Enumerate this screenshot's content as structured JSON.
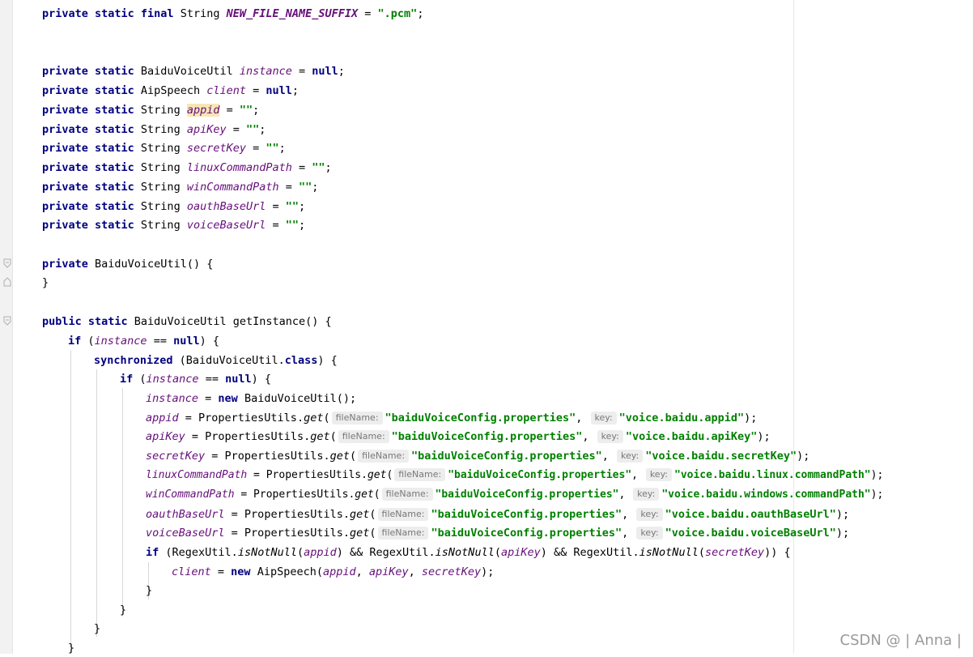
{
  "code": {
    "l01": {
      "a": "private static final",
      "b": " String ",
      "c": "NEW_FILE_NAME_SUFFIX",
      "d": " = ",
      "e": "\".pcm\"",
      "f": ";"
    },
    "l02": {
      "a": "private static",
      "b": " BaiduVoiceUtil ",
      "c": "instance",
      "d": " = ",
      "e": "null",
      "f": ";"
    },
    "l03": {
      "a": "private static",
      "b": " AipSpeech ",
      "c": "client",
      "d": " = ",
      "e": "null",
      "f": ";"
    },
    "l04": {
      "a": "private static",
      "b": " String ",
      "c": "appid",
      "d": " = ",
      "e": "\"\"",
      "f": ";"
    },
    "l05": {
      "a": "private static",
      "b": " String ",
      "c": "apiKey",
      "d": " = ",
      "e": "\"\"",
      "f": ";"
    },
    "l06": {
      "a": "private static",
      "b": " String ",
      "c": "secretKey",
      "d": " = ",
      "e": "\"\"",
      "f": ";"
    },
    "l07": {
      "a": "private static",
      "b": " String ",
      "c": "linuxCommandPath",
      "d": " = ",
      "e": "\"\"",
      "f": ";"
    },
    "l08": {
      "a": "private static",
      "b": " String ",
      "c": "winCommandPath",
      "d": " = ",
      "e": "\"\"",
      "f": ";"
    },
    "l09": {
      "a": "private static",
      "b": " String ",
      "c": "oauthBaseUrl",
      "d": " = ",
      "e": "\"\"",
      "f": ";"
    },
    "l10": {
      "a": "private static",
      "b": " String ",
      "c": "voiceBaseUrl",
      "d": " = ",
      "e": "\"\"",
      "f": ";"
    },
    "l11": {
      "a": "private",
      "b": " BaiduVoiceUtil() {"
    },
    "l12": {
      "a": "}"
    },
    "l13": {
      "a": "public static",
      "b": " BaiduVoiceUtil getInstance() {"
    },
    "l14": {
      "a": "if",
      "b": " (",
      "c": "instance",
      "d": " == ",
      "e": "null",
      "f": ") {"
    },
    "l15": {
      "a": "synchronized",
      "b": " (BaiduVoiceUtil.",
      "c": "class",
      "d": ") {"
    },
    "l16": {
      "a": "if",
      "b": " (",
      "c": "instance",
      "d": " == ",
      "e": "null",
      "f": ") {"
    },
    "l17": {
      "a": "instance",
      "b": " = ",
      "c": "new",
      "d": " BaiduVoiceUtil();"
    },
    "l18": {
      "a": "appid",
      "b": " = PropertiesUtils.",
      "c": "get",
      "d": "(",
      "h1": "fileName:",
      "s1": "\"baiduVoiceConfig.properties\"",
      "m": ", ",
      "h2": "key:",
      "s2": "\"voice.baidu.appid\"",
      "e": ");"
    },
    "l19": {
      "a": "apiKey",
      "b": " = PropertiesUtils.",
      "c": "get",
      "d": "(",
      "h1": "fileName:",
      "s1": "\"baiduVoiceConfig.properties\"",
      "m": ", ",
      "h2": "key:",
      "s2": "\"voice.baidu.apiKey\"",
      "e": ");"
    },
    "l20": {
      "a": "secretKey",
      "b": " = PropertiesUtils.",
      "c": "get",
      "d": "(",
      "h1": "fileName:",
      "s1": "\"baiduVoiceConfig.properties\"",
      "m": ", ",
      "h2": "key:",
      "s2": "\"voice.baidu.secretKey\"",
      "e": ");"
    },
    "l21": {
      "a": "linuxCommandPath",
      "b": " = PropertiesUtils.",
      "c": "get",
      "d": "(",
      "h1": "fileName:",
      "s1": "\"baiduVoiceConfig.properties\"",
      "m": ", ",
      "h2": "key:",
      "s2": "\"voice.baidu.linux.commandPath\"",
      "e": ");"
    },
    "l22": {
      "a": "winCommandPath",
      "b": " = PropertiesUtils.",
      "c": "get",
      "d": "(",
      "h1": "fileName:",
      "s1": "\"baiduVoiceConfig.properties\"",
      "m": ", ",
      "h2": "key:",
      "s2": "\"voice.baidu.windows.commandPath\"",
      "e": ");"
    },
    "l23": {
      "a": "oauthBaseUrl",
      "b": " = PropertiesUtils.",
      "c": "get",
      "d": "(",
      "h1": "fileName:",
      "s1": "\"baiduVoiceConfig.properties\"",
      "m": ", ",
      "h2": "key:",
      "s2": "\"voice.baidu.oauthBaseUrl\"",
      "e": ");"
    },
    "l24": {
      "a": "voiceBaseUrl",
      "b": " = PropertiesUtils.",
      "c": "get",
      "d": "(",
      "h1": "fileName:",
      "s1": "\"baiduVoiceConfig.properties\"",
      "m": ", ",
      "h2": "key:",
      "s2": "\"voice.baidu.voiceBaseUrl\"",
      "e": ");"
    },
    "l25": {
      "a": "if",
      "b": " (RegexUtil.",
      "c": "isNotNull",
      "d": "(",
      "e": "appid",
      "f": ") && RegexUtil.",
      "g": "isNotNull",
      "h": "(",
      "i": "apiKey",
      "j": ") && RegexUtil.",
      "k": "isNotNull",
      "l": "(",
      "n": "secretKey",
      "o": ")) {"
    },
    "l26": {
      "a": "client",
      "b": " = ",
      "c": "new",
      "d": " AipSpeech(",
      "e": "appid",
      "f": ", ",
      "g": "apiKey",
      "h": ", ",
      "i": "secretKey",
      "j": ");"
    },
    "l27": {
      "a": "}"
    },
    "l28": {
      "a": "}"
    },
    "l29": {
      "a": "}"
    },
    "l30": {
      "a": "}"
    }
  },
  "watermark": "CSDN @ | Anna |",
  "colors": {
    "keyword": "#000080",
    "field": "#660e7a",
    "string": "#008000",
    "hint_bg": "#ededed"
  }
}
